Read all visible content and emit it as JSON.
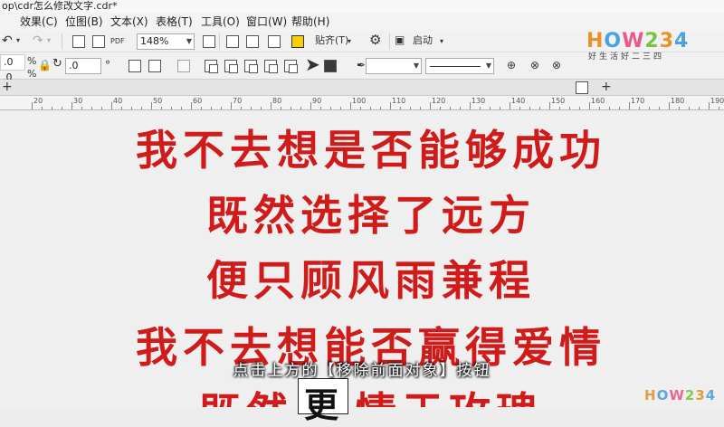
{
  "window": {
    "title": "op\\cdr怎么修改文字.cdr*"
  },
  "menu": {
    "items": [
      "效果(C)",
      "位图(B)",
      "文本(X)",
      "表格(T)",
      "工具(O)",
      "窗口(W)",
      "帮助(H)"
    ]
  },
  "toolbar": {
    "zoom_value": "148%",
    "pdf_label": "PDF",
    "snap_label": "贴齐(T)",
    "launch_label": "启动",
    "rotation_value": ".0",
    "x_value1": ".0",
    "x_value2": ".0",
    "percent1": "%",
    "percent2": "%"
  },
  "tabs": {
    "add_label": "+"
  },
  "ruler": {
    "ticks": [
      "20",
      "30",
      "40",
      "50",
      "60",
      "70",
      "80",
      "90",
      "100",
      "110",
      "120",
      "130",
      "140",
      "150",
      "160",
      "170",
      "180",
      "190"
    ]
  },
  "document": {
    "lines": [
      "我不去想是否能够成功",
      "既然选择了远方",
      "便只顾风雨兼程",
      "我不去想能否赢得爱情",
      "既然"
    ],
    "partial_last_line": "情于玫瑰",
    "boxed_char": "更"
  },
  "caption": {
    "text": "点击上方的【移除前面对象】按钮"
  },
  "brand": {
    "logo_text": "HOW234",
    "slogan": "好生活好二三四"
  },
  "colors": {
    "poem_red": "#d01b1b",
    "highlight_yellow": "#f3ea1c"
  }
}
